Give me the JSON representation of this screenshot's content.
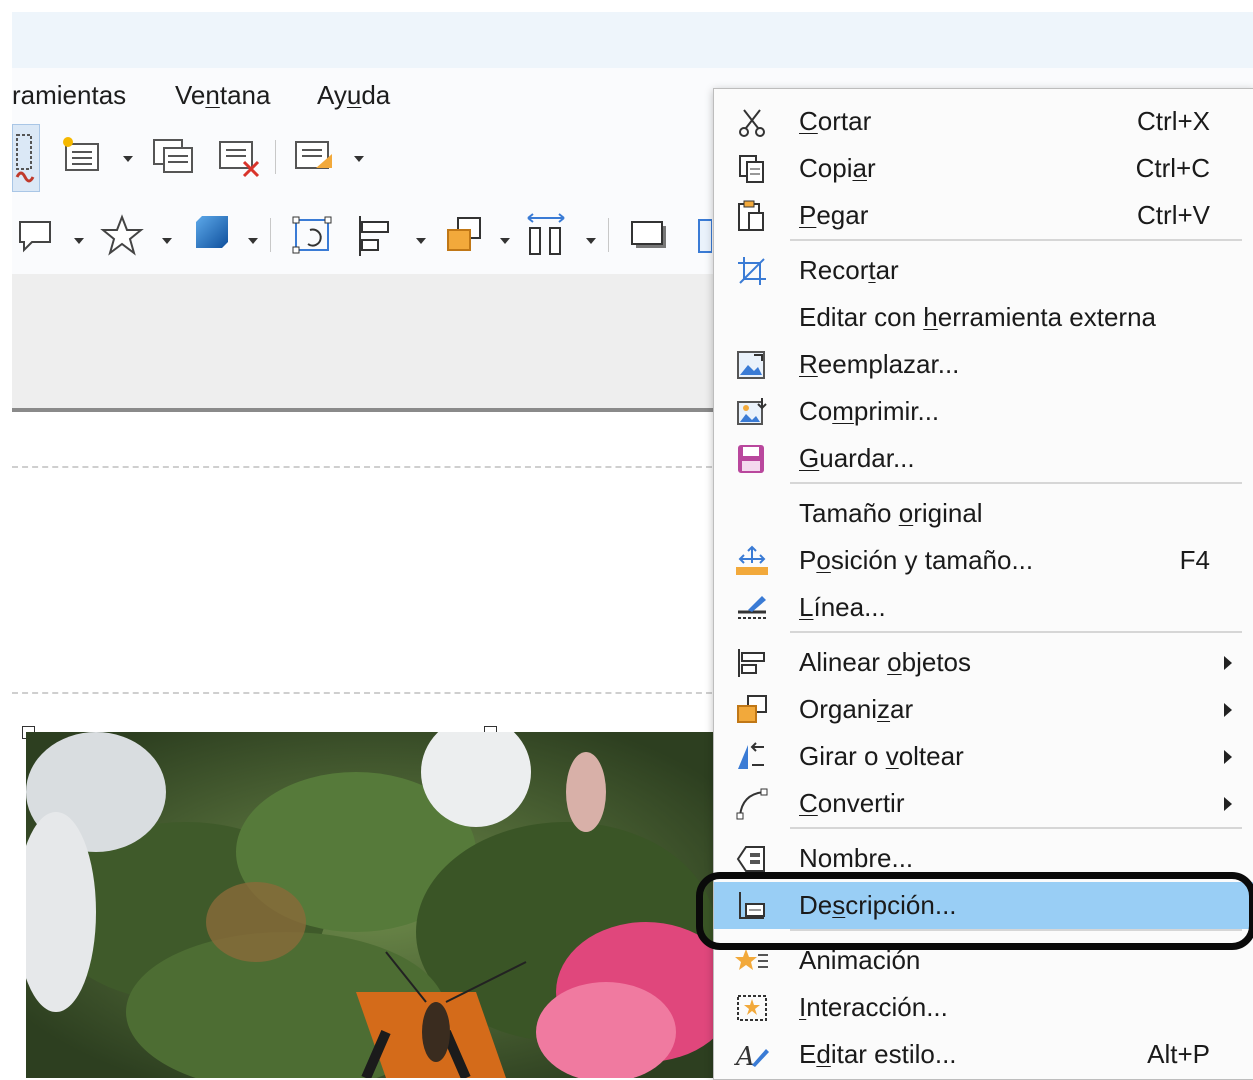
{
  "menubar": {
    "items": [
      {
        "label": "ramientas",
        "underline": ""
      },
      {
        "label": "Ventana",
        "pre": "Ve",
        "ul": "n",
        "post": "tana"
      },
      {
        "label": "Ayuda",
        "pre": "Ay",
        "ul": "u",
        "post": "da"
      }
    ]
  },
  "context_menu": {
    "items": [
      {
        "pre": "",
        "ul": "C",
        "post": "ortar",
        "shortcut": "Ctrl+X",
        "icon": "cut-icon"
      },
      {
        "pre": "Copi",
        "ul": "a",
        "post": "r",
        "shortcut": "Ctrl+C",
        "icon": "copy-icon"
      },
      {
        "pre": "",
        "ul": "P",
        "post": "egar",
        "shortcut": "Ctrl+V",
        "icon": "paste-icon"
      },
      {
        "pre": "Recor",
        "ul": "t",
        "post": "ar",
        "icon": "crop-icon"
      },
      {
        "pre": "Editar con ",
        "ul": "h",
        "post": "erramienta externa"
      },
      {
        "pre": "",
        "ul": "R",
        "post": "eemplazar...",
        "icon": "replace-image-icon"
      },
      {
        "pre": "Co",
        "ul": "m",
        "post": "primir...",
        "icon": "compress-image-icon"
      },
      {
        "pre": "",
        "ul": "G",
        "post": "uardar...",
        "icon": "save-icon"
      },
      {
        "pre": "Tamaño ",
        "ul": "o",
        "post": "riginal"
      },
      {
        "pre": "P",
        "ul": "o",
        "post": "sición y tamaño...",
        "shortcut": "F4",
        "icon": "position-size-icon"
      },
      {
        "pre": "",
        "ul": "L",
        "post": "ínea...",
        "icon": "line-icon"
      },
      {
        "pre": "Alinear ",
        "ul": "o",
        "post": "bjetos",
        "submenu": true,
        "icon": "align-objects-icon"
      },
      {
        "pre": "Organi",
        "ul": "z",
        "post": "ar",
        "submenu": true,
        "icon": "arrange-icon"
      },
      {
        "pre": "Girar o ",
        "ul": "v",
        "post": "oltear",
        "submenu": true,
        "icon": "rotate-flip-icon"
      },
      {
        "pre": "",
        "ul": "C",
        "post": "onvertir",
        "submenu": true,
        "icon": "convert-icon"
      },
      {
        "pre": "Nombre...",
        "ul": "",
        "post": "",
        "icon": "name-icon"
      },
      {
        "pre": "De",
        "ul": "s",
        "post": "cripción...",
        "icon": "description-icon",
        "highlighted": true
      },
      {
        "pre": "Animación",
        "ul": "",
        "post": "",
        "icon": "animation-icon"
      },
      {
        "pre": "",
        "ul": "I",
        "post": "nteracción...",
        "icon": "interaction-icon"
      },
      {
        "pre": "E",
        "ul": "d",
        "post": "itar estilo...",
        "shortcut": "Alt+P",
        "icon": "edit-style-icon"
      }
    ]
  },
  "colors": {
    "highlight": "#99cef5",
    "focus_ring": "#0a0a0a",
    "menu_bg": "#fbfbfb"
  }
}
